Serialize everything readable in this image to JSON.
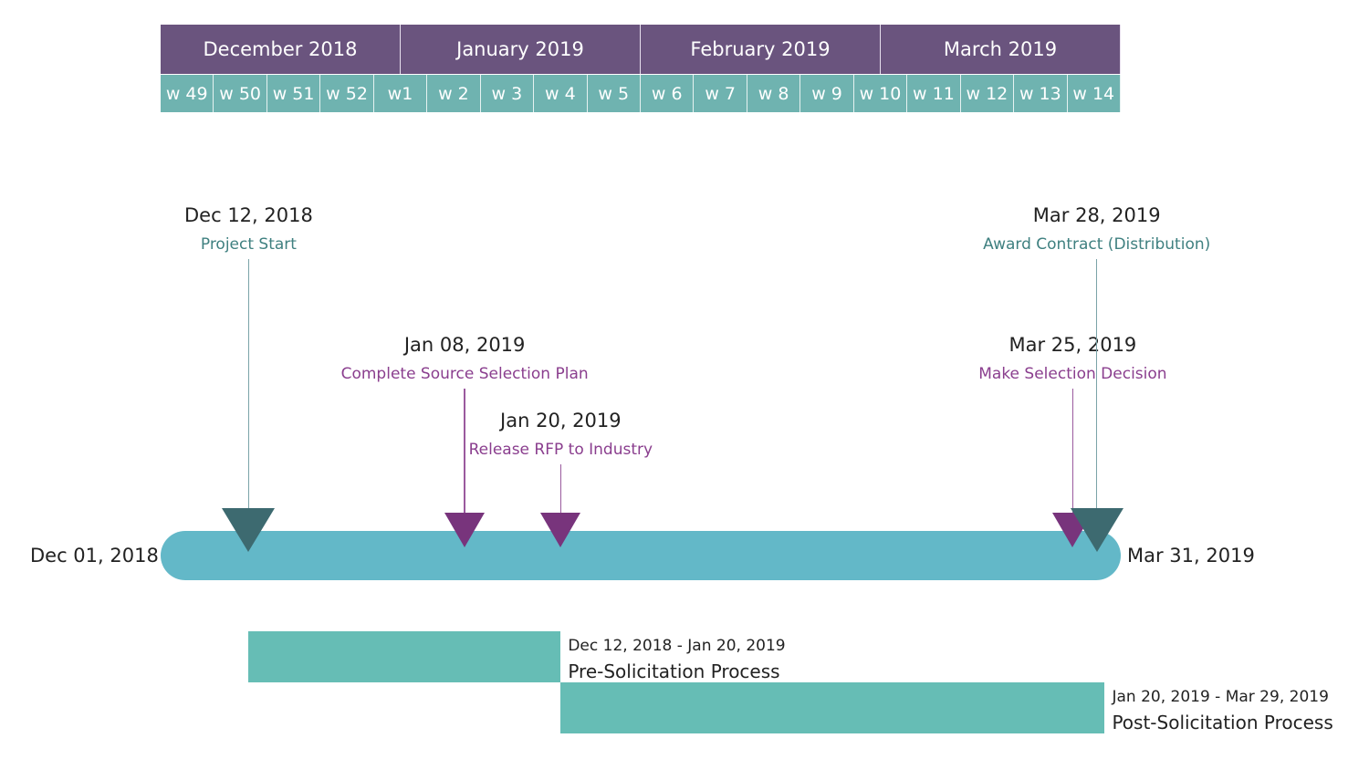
{
  "colors": {
    "month_header": "#6a547e",
    "week_header": "#6fb3b0",
    "axis": "#63b8c8",
    "milestone_major": "#3d6a70",
    "milestone_minor": "#78347c",
    "major_label": "#3f8080",
    "minor_label": "#8a3e8e",
    "phase": "#66bdb5"
  },
  "months": [
    "December 2018",
    "January 2019",
    "February 2019",
    "March 2019"
  ],
  "weeks": [
    "w 49",
    "w 50",
    "w 51",
    "w 52",
    "w1",
    "w 2",
    "w 3",
    "w 4",
    "w 5",
    "w 6",
    "w 7",
    "w 8",
    "w 9",
    "w 10",
    "w 11",
    "w 12",
    "w 13",
    "w 14"
  ],
  "timeline": {
    "start": "Dec 01, 2018",
    "end": "Mar 31, 2019",
    "start_iso": "2018-12-01",
    "end_iso": "2019-03-31"
  },
  "milestones": [
    {
      "date": "Dec 12, 2018",
      "iso": "2018-12-12",
      "name": "Project Start",
      "kind": "major",
      "level": 1
    },
    {
      "date": "Jan 08, 2019",
      "iso": "2019-01-08",
      "name": "Complete Source Selection Plan",
      "kind": "minor",
      "level": 2
    },
    {
      "date": "Jan 20, 2019",
      "iso": "2019-01-20",
      "name": "Release RFP to Industry",
      "kind": "minor",
      "level": 3
    },
    {
      "date": "Mar 25, 2019",
      "iso": "2019-03-25",
      "name": "Make Selection Decision",
      "kind": "minor",
      "level": 2
    },
    {
      "date": "Mar 28, 2019",
      "iso": "2019-03-28",
      "name": "Award Contract (Distribution)",
      "kind": "major",
      "level": 1
    }
  ],
  "phases": [
    {
      "range": "Dec 12, 2018 - Jan 20, 2019",
      "name": "Pre-Solicitation Process",
      "start_iso": "2018-12-12",
      "end_iso": "2019-01-20"
    },
    {
      "range": "Jan 20, 2019 - Mar 29, 2019",
      "name": "Post-Solicitation Process",
      "start_iso": "2019-01-20",
      "end_iso": "2019-03-29"
    }
  ]
}
